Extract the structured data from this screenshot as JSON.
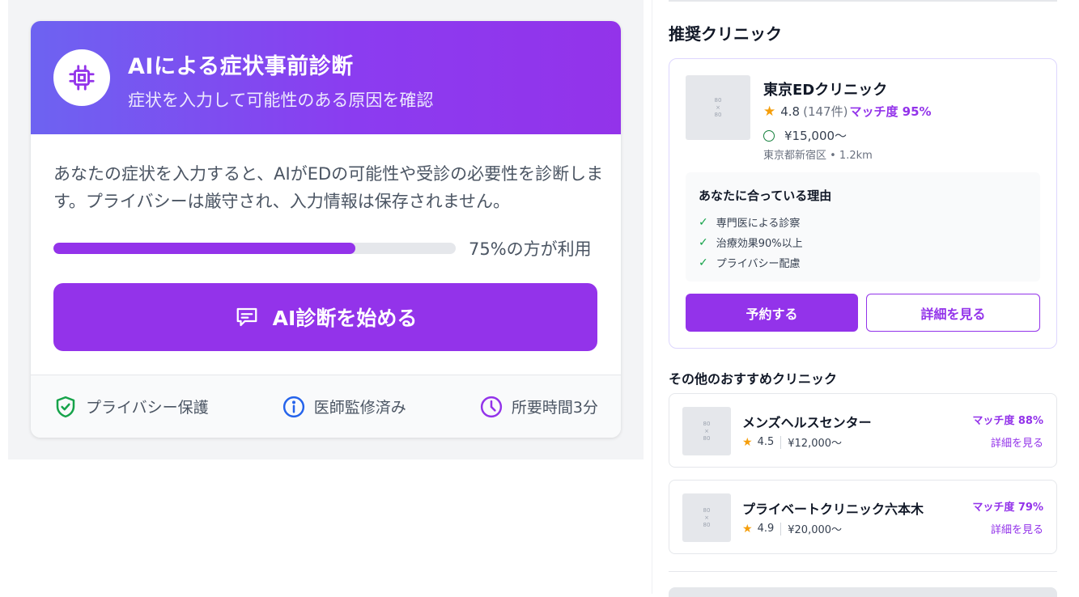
{
  "diagnosis": {
    "title": "AIによる症状事前診断",
    "subtitle": "症状を入力して可能性のある原因を確認",
    "description": "あなたの症状を入力すると、AIがEDの可能性や受診の必要性を診断します。プライバシーは厳守され、入力情報は保存されません。",
    "usage_fraction": 0.75,
    "usage_text": "75%の方が利用",
    "start_label": "AI診断を始める",
    "footer": {
      "privacy": "プライバシー保護",
      "supervised": "医師監修済み",
      "duration": "所要時間3分"
    },
    "icons": {
      "header": "chip-icon",
      "start": "chat-icon",
      "privacy": "shield-check-icon",
      "supervised": "info-icon",
      "duration": "clock-icon"
    },
    "colors": {
      "accent": "#9333ea",
      "gradient_start": "#6d63f1"
    }
  },
  "sidebar": {
    "section_title": "推奨クリニック",
    "recommended": {
      "thumb_text": "80\n×\n80",
      "name": "東京EDクリニック",
      "rating": "4.8",
      "review_count": "(147件)",
      "match": "マッチ度 95%",
      "price": "¥15,000〜",
      "location": "東京都新宿区 • 1.2km",
      "reasons_title": "あなたに合っている理由",
      "reasons": [
        "専門医による診察",
        "治療効果90%以上",
        "プライバシー配慮"
      ],
      "reserve_label": "予約する",
      "detail_label": "詳細を見る"
    },
    "others_title": "その他のおすすめクリニック",
    "others": [
      {
        "name": "メンズヘルスセンター",
        "rating": "4.5",
        "price": "¥12,000〜",
        "match": "マッチ度 88%",
        "link": "詳細を見る"
      },
      {
        "name": "プライベートクリニック六本木",
        "rating": "4.9",
        "price": "¥20,000〜",
        "match": "マッチ度 79%",
        "link": "詳細を見る"
      }
    ]
  }
}
